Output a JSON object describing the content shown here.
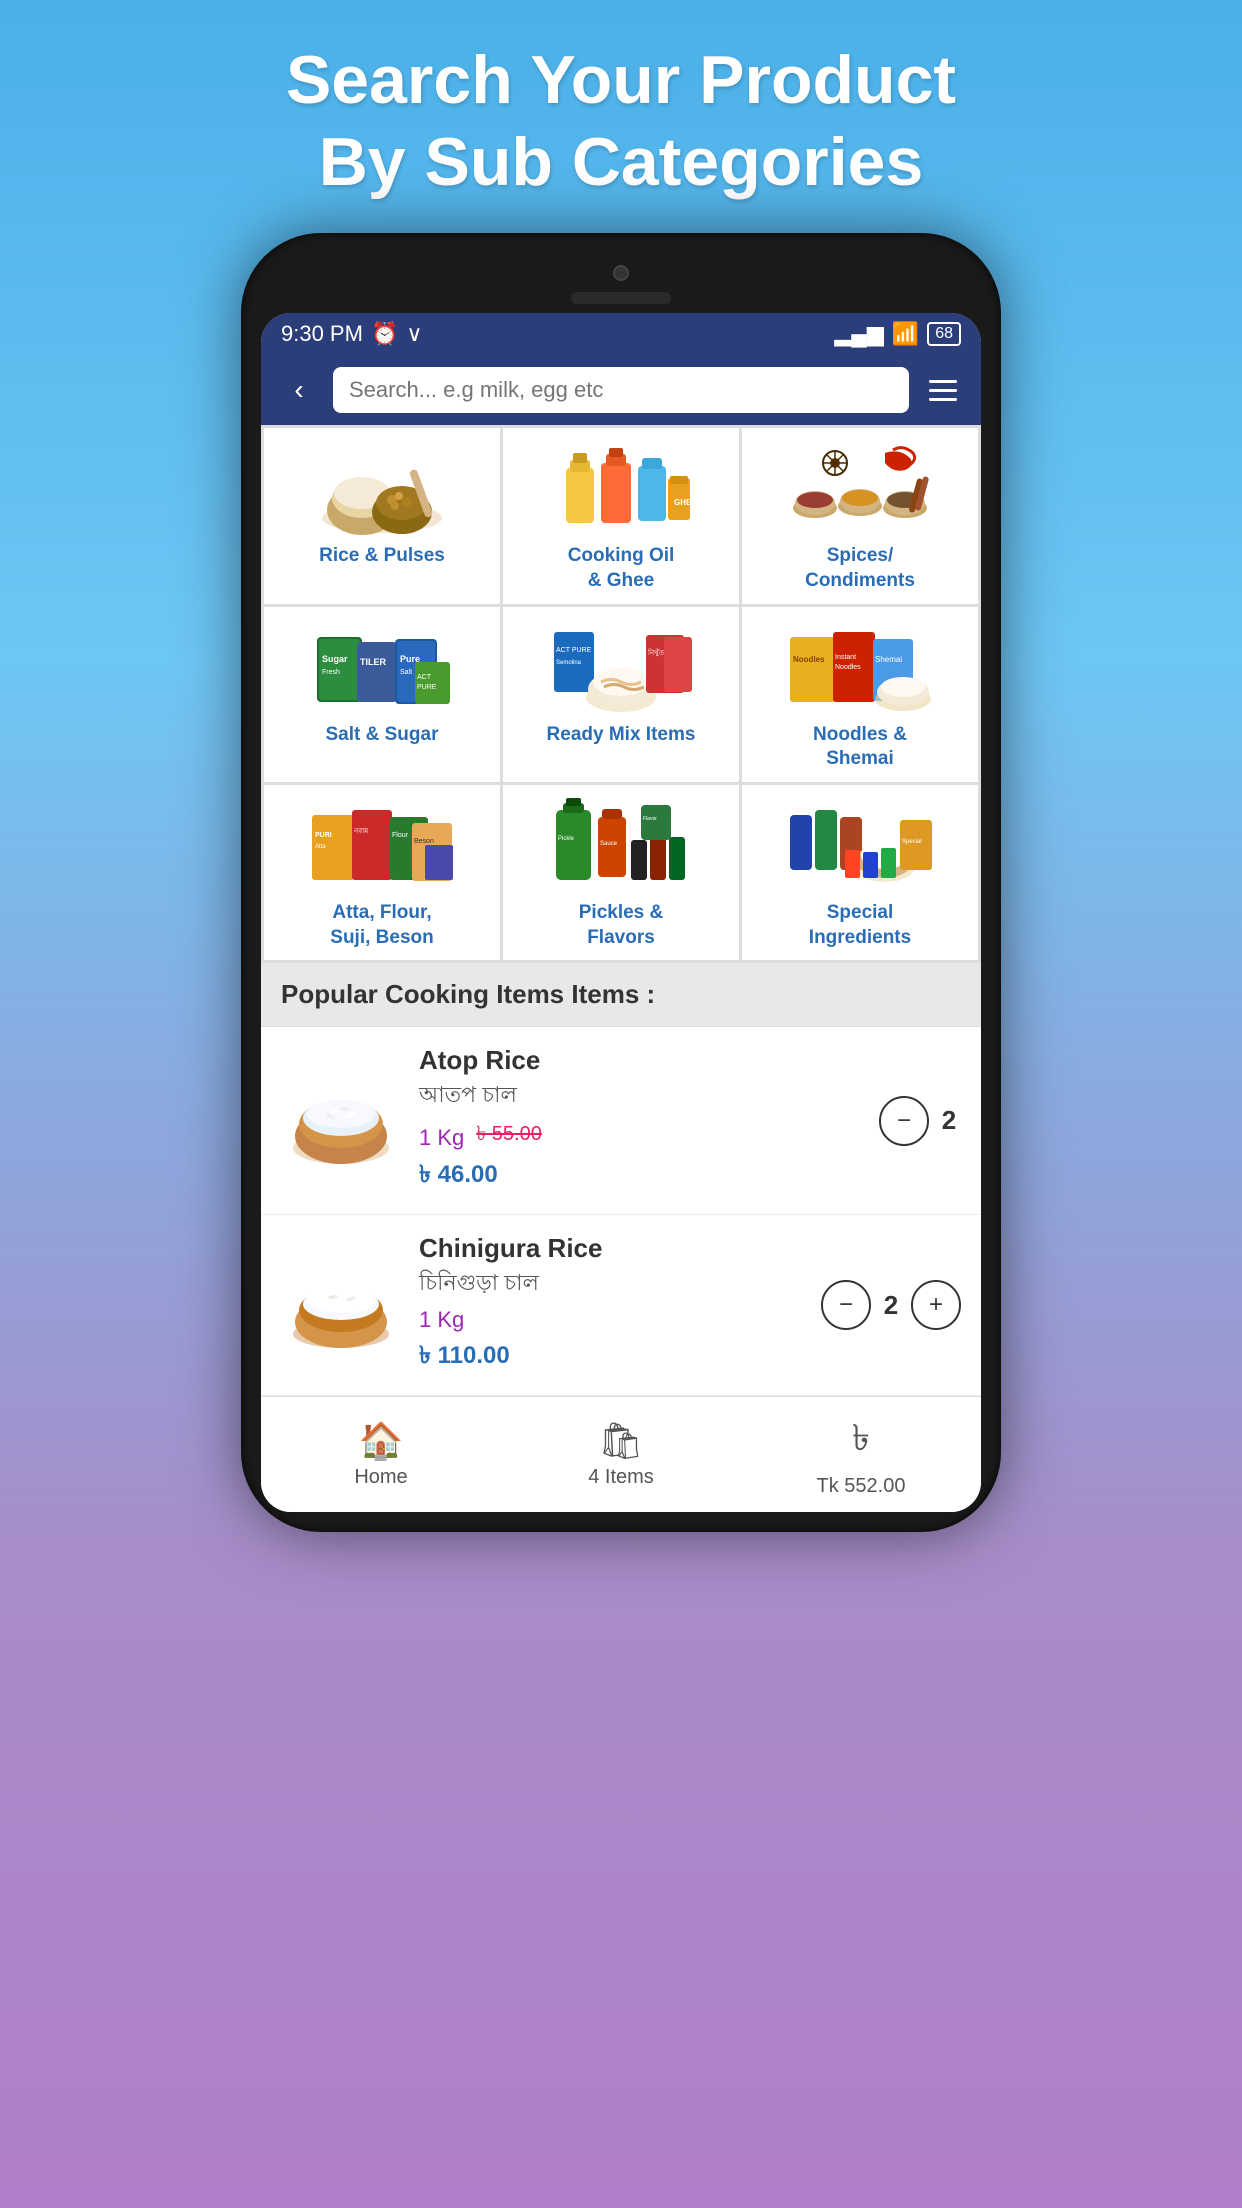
{
  "page": {
    "header_line1": "Search Your Product",
    "header_line2": "By Sub Categories"
  },
  "status_bar": {
    "time": "9:30 PM",
    "battery": "68"
  },
  "nav": {
    "search_placeholder": "Search... e.g milk, egg etc",
    "back_label": "<"
  },
  "categories": [
    {
      "id": "rice-pulses",
      "label": "Rice & Pulses",
      "emoji": "🌾"
    },
    {
      "id": "cooking-oil",
      "label": "Cooking Oil\n& Ghee",
      "emoji": "🫙"
    },
    {
      "id": "spices",
      "label": "Spices/\nCondiments",
      "emoji": "🌶"
    },
    {
      "id": "salt-sugar",
      "label": "Salt & Sugar",
      "emoji": "🧂"
    },
    {
      "id": "ready-mix",
      "label": "Ready Mix Items",
      "emoji": "🍜"
    },
    {
      "id": "noodles",
      "label": "Noodles &\nShemai",
      "emoji": "🍝"
    },
    {
      "id": "atta-flour",
      "label": "Atta, Flour,\nSuji, Beson",
      "emoji": "🌾"
    },
    {
      "id": "pickles",
      "label": "Pickles &\nFlavors",
      "emoji": "🫙"
    },
    {
      "id": "special",
      "label": "Special\nIngredients",
      "emoji": "✨"
    }
  ],
  "popular_section": {
    "title": "Popular Cooking Items Items :"
  },
  "products": [
    {
      "id": "atop-rice",
      "name_en": "Atop Rice",
      "name_bn": "আতপ চাল",
      "weight": "1 Kg",
      "price_old": "৳ 55.00",
      "price_new": "৳ 46.00",
      "qty": "2",
      "emoji": "🍚"
    },
    {
      "id": "chinigura-rice",
      "name_en": "Chinigura Rice",
      "name_bn": "চিনিগুড়া চাল",
      "weight": "1 Kg",
      "price_old": "",
      "price_new": "৳ 110.00",
      "qty": "2",
      "emoji": "🍚"
    }
  ],
  "tab_bar": {
    "home_label": "Home",
    "cart_label": "4 Items",
    "total_label": "Tk 552.00"
  }
}
